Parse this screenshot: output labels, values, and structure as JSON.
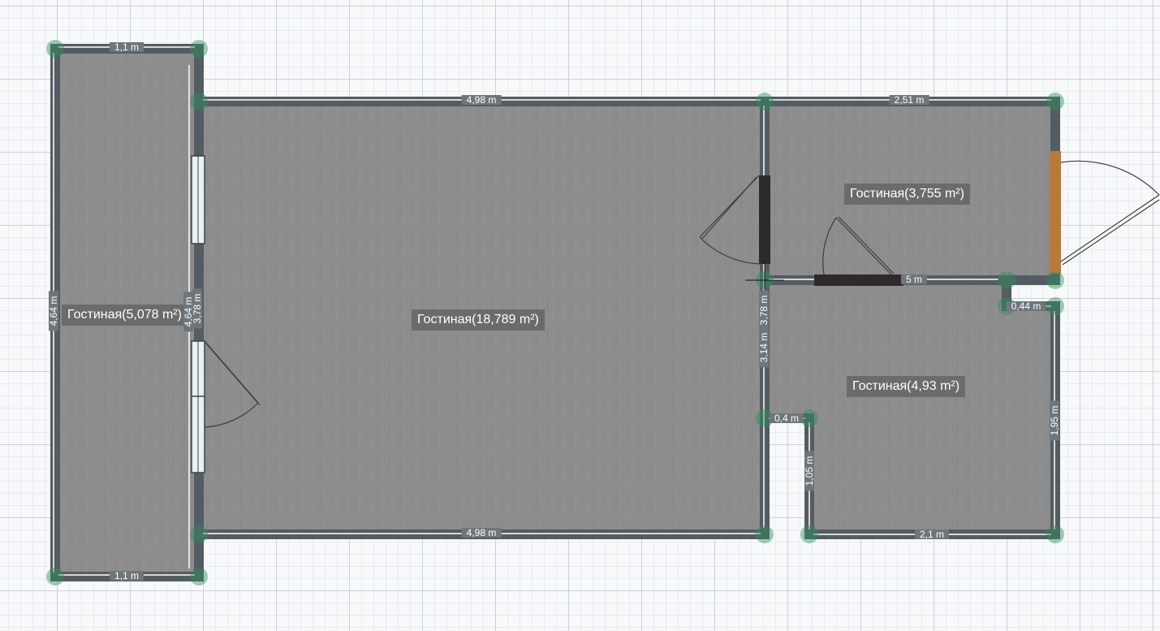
{
  "rooms": [
    {
      "label": "Гостиная(5,078 m²)"
    },
    {
      "label": "Гостиная(18,789 m²)"
    },
    {
      "label": "Гостиная(3,755 m²)"
    },
    {
      "label": "Гостиная(4,93 m²)"
    }
  ],
  "dimensions": {
    "narrow_top": "1,1 m",
    "narrow_bottom": "1,1 m",
    "narrow_left": "4,64 m",
    "narrow_right": "4,64 m",
    "main_top": "4,98 m",
    "main_bottom": "4,98 m",
    "main_right_a": "3,78 m",
    "main_right_b": "3,78 m",
    "main_right_c": "3,14 m",
    "small_top": "2,51 m",
    "small_bottom": "5 m",
    "step_top": "0,44 m",
    "step_left": "0,4 m",
    "right_side": "1,95 m",
    "inner_side": "1,05 m",
    "bottom_right": "2,1 m"
  },
  "colors": {
    "floor": "#8f8f8f",
    "wall": "#545c63",
    "vertex": "#2f8f5f",
    "door_wood": "#b67a3f"
  }
}
